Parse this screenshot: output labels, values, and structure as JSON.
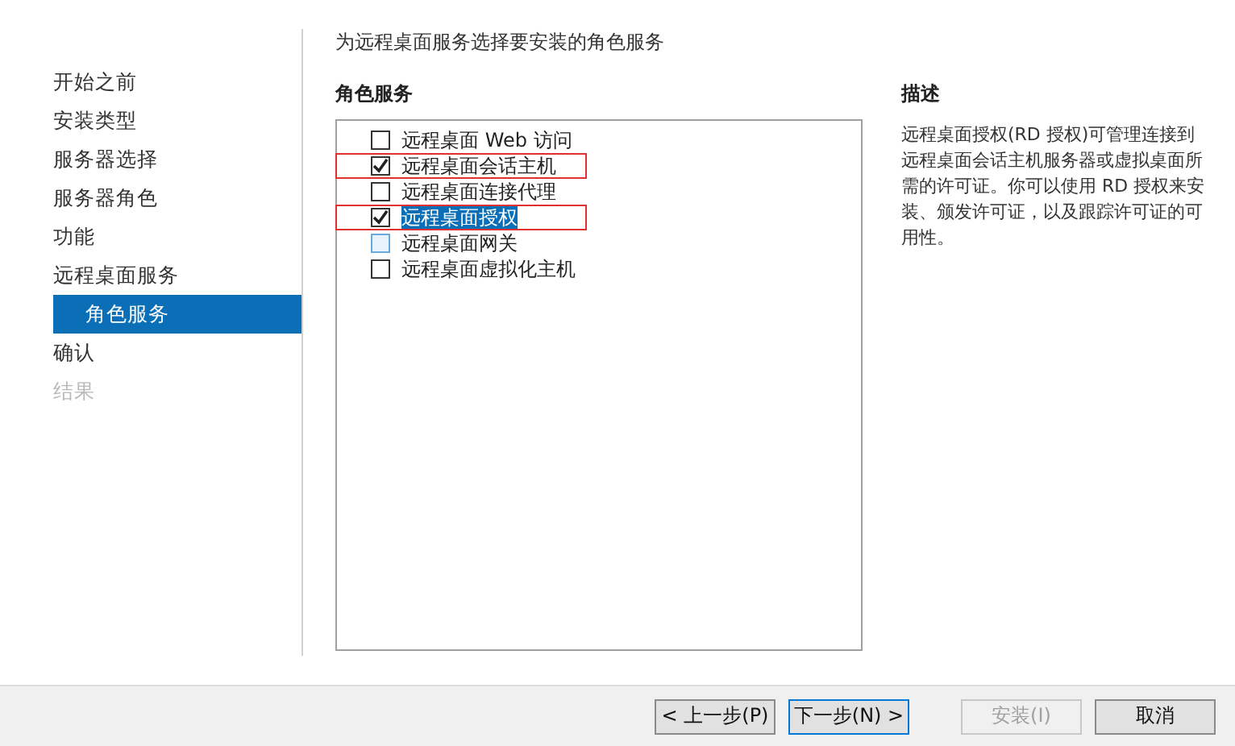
{
  "sidebar": {
    "items": [
      {
        "label": "开始之前",
        "selected": false,
        "disabled": false
      },
      {
        "label": "安装类型",
        "selected": false,
        "disabled": false
      },
      {
        "label": "服务器选择",
        "selected": false,
        "disabled": false
      },
      {
        "label": "服务器角色",
        "selected": false,
        "disabled": false
      },
      {
        "label": "功能",
        "selected": false,
        "disabled": false
      },
      {
        "label": "远程桌面服务",
        "selected": false,
        "disabled": false,
        "children": [
          {
            "label": "角色服务",
            "selected": true,
            "disabled": false
          }
        ]
      },
      {
        "label": "确认",
        "selected": false,
        "disabled": false
      },
      {
        "label": "结果",
        "selected": false,
        "disabled": true
      }
    ]
  },
  "heading": "为远程桌面服务选择要安装的角色服务",
  "role_services": {
    "title": "角色服务",
    "items": [
      {
        "label": "远程桌面 Web 访问",
        "checked": false,
        "selected": false,
        "hovered": false,
        "highlighted": false
      },
      {
        "label": "远程桌面会话主机",
        "checked": true,
        "selected": false,
        "hovered": false,
        "highlighted": true
      },
      {
        "label": "远程桌面连接代理",
        "checked": false,
        "selected": false,
        "hovered": false,
        "highlighted": false
      },
      {
        "label": "远程桌面授权",
        "checked": true,
        "selected": true,
        "hovered": false,
        "highlighted": true
      },
      {
        "label": "远程桌面网关",
        "checked": false,
        "selected": false,
        "hovered": true,
        "highlighted": false
      },
      {
        "label": "远程桌面虚拟化主机",
        "checked": false,
        "selected": false,
        "hovered": false,
        "highlighted": false
      }
    ]
  },
  "description": {
    "title": "描述",
    "text": "远程桌面授权(RD 授权)可管理连接到远程桌面会话主机服务器或虚拟桌面所需的许可证。你可以使用 RD 授权来安装、颁发许可证，以及跟踪许可证的可用性。"
  },
  "buttons": [
    {
      "label": "< 上一步(P)",
      "disabled": false,
      "focused": false
    },
    {
      "label": "下一步(N) >",
      "disabled": false,
      "focused": true
    },
    {
      "label": "安装(I)",
      "disabled": true,
      "focused": false
    },
    {
      "label": "取消",
      "disabled": false,
      "focused": false
    }
  ]
}
